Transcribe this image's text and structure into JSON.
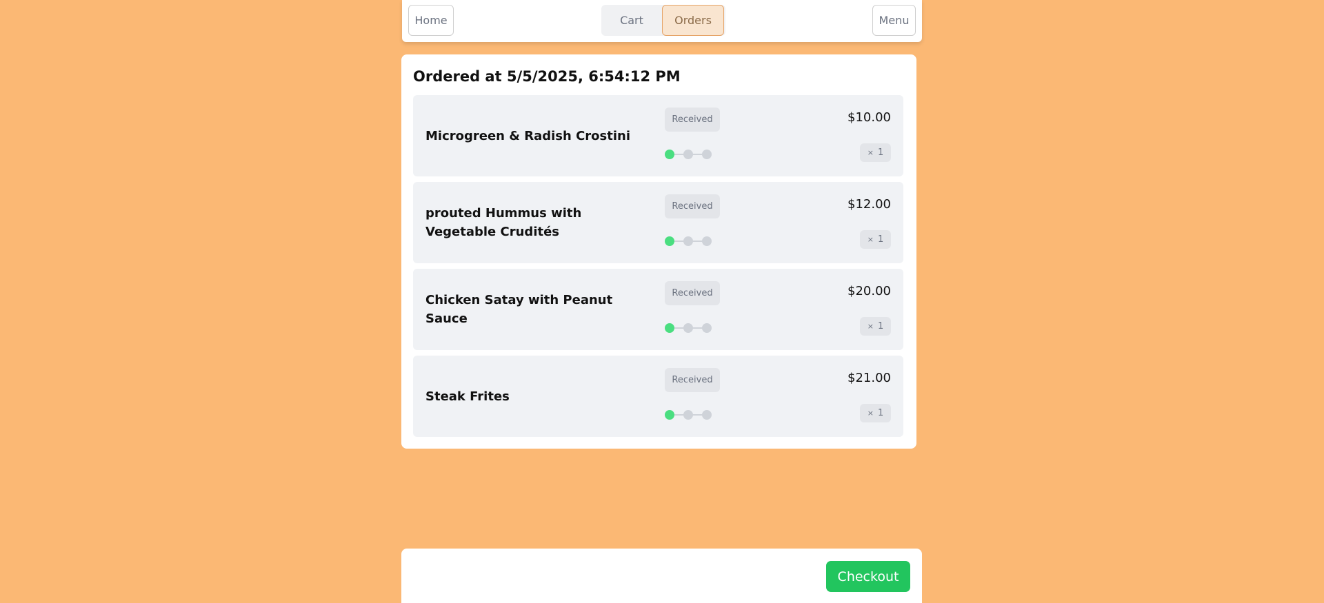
{
  "nav": {
    "home_label": "Home",
    "cart_label": "Cart",
    "orders_label": "Orders",
    "menu_label": "Menu",
    "active_tab": "Orders"
  },
  "order": {
    "title": "Ordered at 5/5/2025, 6:54:12 PM",
    "items": [
      {
        "name": "Microgreen & Radish Crostini",
        "status": "Received",
        "price": "$10.00",
        "qty_symbol": "×",
        "qty": "1",
        "progress_step": 1,
        "progress_steps": 3
      },
      {
        "name": "prouted Hummus with Vegetable Crudités",
        "status": "Received",
        "price": "$12.00",
        "qty_symbol": "×",
        "qty": "1",
        "progress_step": 1,
        "progress_steps": 3
      },
      {
        "name": "Chicken Satay with Peanut Sauce",
        "status": "Received",
        "price": "$20.00",
        "qty_symbol": "×",
        "qty": "1",
        "progress_step": 1,
        "progress_steps": 3
      },
      {
        "name": "Steak Frites",
        "status": "Received",
        "price": "$21.00",
        "qty_symbol": "×",
        "qty": "1",
        "progress_step": 1,
        "progress_steps": 3
      }
    ]
  },
  "footer": {
    "checkout_label": "Checkout"
  },
  "colors": {
    "background": "#fbb874",
    "accent_green": "#22c55e",
    "progress_active": "#4ade80",
    "orders_tab_bg": "#f9e5d0"
  }
}
